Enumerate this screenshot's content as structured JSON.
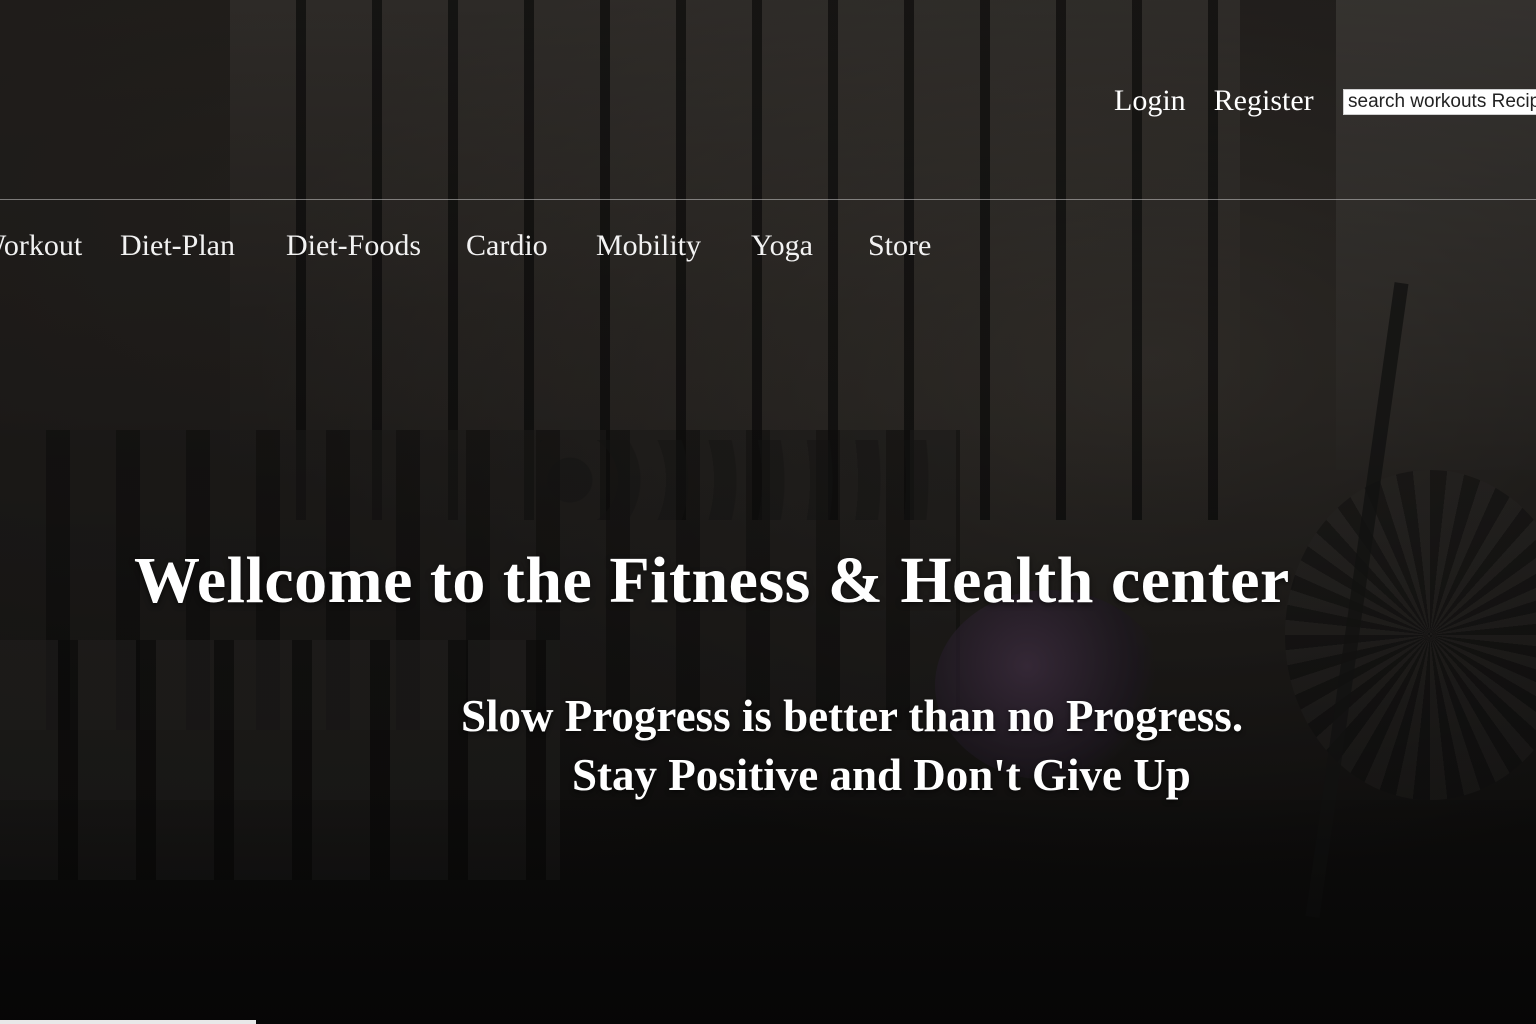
{
  "header": {
    "auth": {
      "login_label": "Login",
      "register_label": "Register"
    },
    "search": {
      "placeholder": "search workouts Recipes"
    }
  },
  "nav": {
    "items": [
      {
        "label": "Workout"
      },
      {
        "label": "Diet-Plan"
      },
      {
        "label": "Diet-Foods"
      },
      {
        "label": "Cardio"
      },
      {
        "label": "Mobility"
      },
      {
        "label": "Yoga"
      },
      {
        "label": "Store"
      }
    ]
  },
  "hero": {
    "title": "Wellcome to the Fitness & Health center",
    "tagline_line1": "Slow Progress is better than no Progress.",
    "tagline_line2": "Stay Positive and Don't Give Up"
  },
  "colors": {
    "text": "#ffffff",
    "background": "#141312",
    "divider": "#c8c8c8"
  }
}
